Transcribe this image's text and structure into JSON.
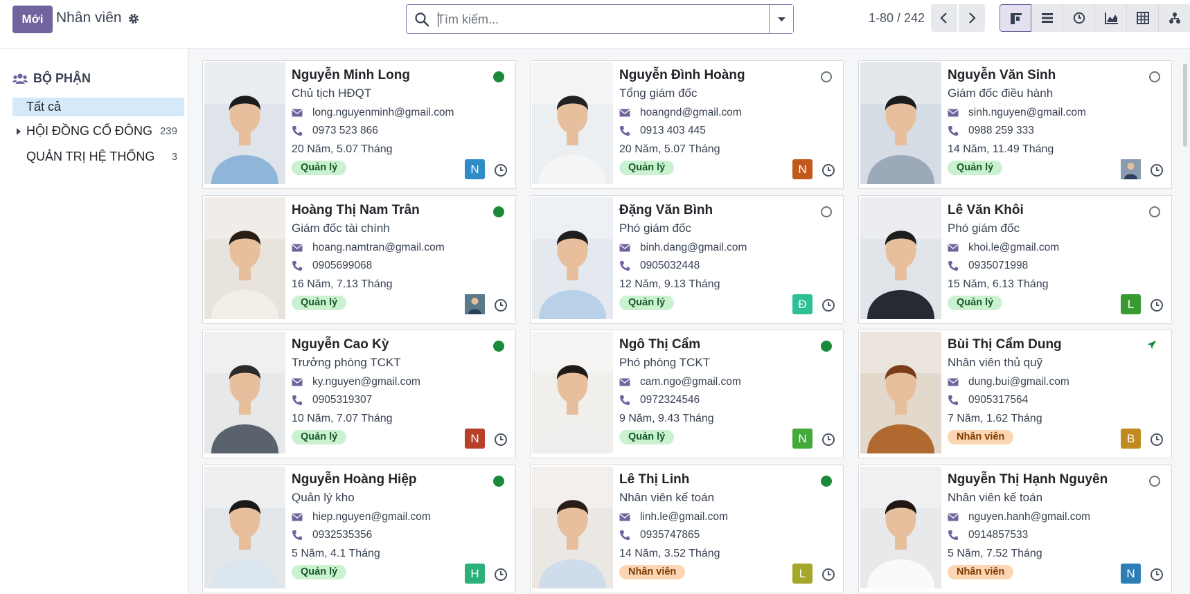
{
  "header": {
    "new_button": "Mới",
    "title": "Nhân viên",
    "search_placeholder": "Tìm kiếm...",
    "pager": "1-80 / 242",
    "views": [
      "kanban-icon",
      "list-icon",
      "activity-icon",
      "graph-icon",
      "pivot-icon",
      "hierarchy-icon"
    ]
  },
  "sidebar": {
    "heading": "BỘ PHẬN",
    "items": [
      {
        "label": "Tất cả",
        "count": "",
        "active": true
      },
      {
        "label": "HỘI ĐỒNG CỔ ĐÔNG",
        "count": "239",
        "active": false
      },
      {
        "label": "QUẢN TRỊ HỆ THỐNG",
        "count": "3",
        "active": false
      }
    ]
  },
  "employees": [
    {
      "name": "Nguyễn Minh Long",
      "job": "Chủ tịch HĐQT",
      "email": "long.nguyenminh@gmail.com",
      "phone": "0973 523 866",
      "tenure": "20 Năm, 5.07 Tháng",
      "tag": "Quản lý",
      "tag_color": "green",
      "status": "online",
      "avatar": "N",
      "avatar_color": "#2e8cc6"
    },
    {
      "name": "Nguyễn Đình Hoàng",
      "job": "Tổng giám đốc",
      "email": "hoangnd@gmail.com",
      "phone": "0913 403 445",
      "tenure": "20 Năm, 5.07 Tháng",
      "tag": "Quản lý",
      "tag_color": "green",
      "status": "offline",
      "avatar": "N",
      "avatar_color": "#c35a1d"
    },
    {
      "name": "Nguyễn Văn Sinh",
      "job": "Giám đốc điều hành",
      "email": "sinh.nguyen@gmail.com",
      "phone": "0988 259 333",
      "tenure": "14 Năm, 11.49 Tháng",
      "tag": "Quản lý",
      "tag_color": "green",
      "status": "offline",
      "avatar": "",
      "avatar_color": "#8b9bb0"
    },
    {
      "name": "Hoàng Thị Nam Trân",
      "job": "Giám đốc tài chính",
      "email": "hoang.namtran@gmail.com",
      "phone": "0905699068",
      "tenure": "16 Năm, 7.13 Tháng",
      "tag": "Quản lý",
      "tag_color": "green",
      "status": "online",
      "avatar": "",
      "avatar_color": "#5a7a8a"
    },
    {
      "name": "Đặng Văn Bình",
      "job": "Phó giám đốc",
      "email": "binh.dang@gmail.com",
      "phone": "0905032448",
      "tenure": "12 Năm, 9.13 Tháng",
      "tag": "Quản lý",
      "tag_color": "green",
      "status": "offline",
      "avatar": "Đ",
      "avatar_color": "#2fbf94"
    },
    {
      "name": "Lê Văn Khôi",
      "job": "Phó giám đốc",
      "email": "khoi.le@gmail.com",
      "phone": "0935071998",
      "tenure": "15 Năm, 6.13 Tháng",
      "tag": "Quản lý",
      "tag_color": "green",
      "status": "offline",
      "avatar": "L",
      "avatar_color": "#3a9a32"
    },
    {
      "name": "Nguyễn Cao Kỳ",
      "job": "Trưởng phòng TCKT",
      "email": "ky.nguyen@gmail.com",
      "phone": "0905319307",
      "tenure": "10 Năm, 7.07 Tháng",
      "tag": "Quản lý",
      "tag_color": "green",
      "status": "online",
      "avatar": "N",
      "avatar_color": "#b8402a"
    },
    {
      "name": "Ngô Thị Cẩm",
      "job": "Phó phòng TCKT",
      "email": "cam.ngo@gmail.com",
      "phone": "0972324546",
      "tenure": "9 Năm, 9.43 Tháng",
      "tag": "Quản lý",
      "tag_color": "green",
      "status": "online",
      "avatar": "N",
      "avatar_color": "#43a93a"
    },
    {
      "name": "Bùi Thị Cẩm Dung",
      "job": "Nhân viên thủ quỹ",
      "email": "dung.bui@gmail.com",
      "phone": "0905317564",
      "tenure": "7 Năm, 1.62 Tháng",
      "tag": "Nhân viên",
      "tag_color": "orange",
      "status": "plane",
      "avatar": "B",
      "avatar_color": "#c08a1e"
    },
    {
      "name": "Nguyễn Hoàng Hiệp",
      "job": "Quản lý kho",
      "email": "hiep.nguyen@gmail.com",
      "phone": "0932535356",
      "tenure": "5 Năm, 4.1 Tháng",
      "tag": "Quản lý",
      "tag_color": "green",
      "status": "online",
      "avatar": "H",
      "avatar_color": "#2bb07a"
    },
    {
      "name": "Lê Thị Linh",
      "job": "Nhân viên kế toán",
      "email": "linh.le@gmail.com",
      "phone": "0935747865",
      "tenure": "14 Năm, 3.52 Tháng",
      "tag": "Nhân viên",
      "tag_color": "orange",
      "status": "online",
      "avatar": "L",
      "avatar_color": "#a4a82a"
    },
    {
      "name": "Nguyễn Thị Hạnh Nguyên",
      "job": "Nhân viên kế toán",
      "email": "nguyen.hanh@gmail.com",
      "phone": "0914857533",
      "tenure": "5 Năm, 7.52 Tháng",
      "tag": "Nhân viên",
      "tag_color": "orange",
      "status": "offline",
      "avatar": "N",
      "avatar_color": "#2e7fb8"
    }
  ]
}
